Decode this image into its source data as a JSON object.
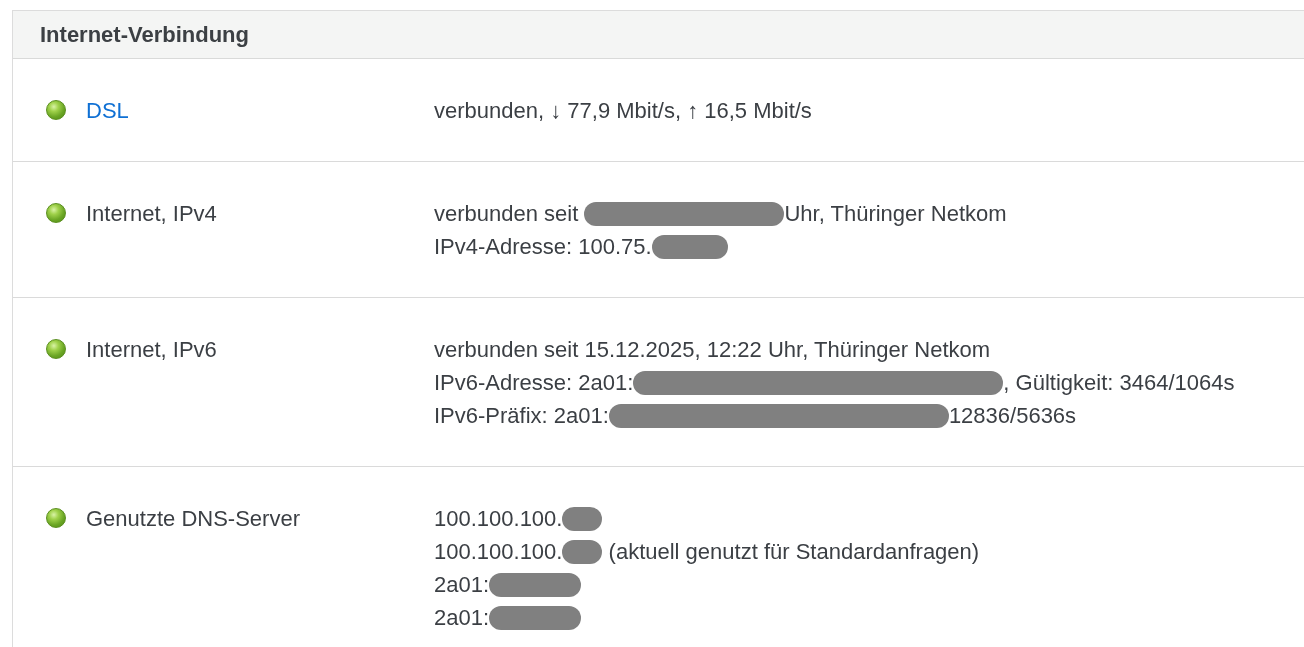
{
  "panel": {
    "title": "Internet-Verbindung"
  },
  "rows": [
    {
      "connected": true,
      "kind": "link",
      "label": "DSL",
      "lines": [
        [
          {
            "kind": "text",
            "text": "verbunden, ↓ 77,9 Mbit/s, ↑ 16,5 Mbit/s"
          }
        ]
      ]
    },
    {
      "connected": true,
      "kind": "text",
      "label": "Internet, IPv4",
      "lines": [
        [
          {
            "kind": "text",
            "text": "verbunden seit "
          },
          {
            "kind": "redacted"
          },
          {
            "kind": "text",
            "text": "Uhr, Thüringer Netkom"
          }
        ],
        [
          {
            "kind": "text",
            "text": "IPv4-Adresse: 100.75."
          },
          {
            "kind": "redacted"
          }
        ]
      ]
    },
    {
      "connected": true,
      "kind": "text",
      "label": "Internet, IPv6",
      "lines": [
        [
          {
            "kind": "text",
            "text": "verbunden seit 15.12.2025, 12:22 Uhr, Thüringer Netkom"
          }
        ],
        [
          {
            "kind": "text",
            "text": "IPv6-Adresse: 2a01:"
          },
          {
            "kind": "redacted"
          },
          {
            "kind": "text",
            "text": ", Gültigkeit: 3464/1064s"
          }
        ],
        [
          {
            "kind": "text",
            "text": "IPv6-Präfix: 2a01:"
          },
          {
            "kind": "redacted"
          },
          {
            "kind": "text",
            "text": "12836/5636s"
          }
        ]
      ]
    },
    {
      "connected": true,
      "kind": "text",
      "label": "Genutzte DNS-Server",
      "lines": [
        [
          {
            "kind": "text",
            "text": "100.100.100."
          },
          {
            "kind": "redacted"
          }
        ],
        [
          {
            "kind": "text",
            "text": "100.100.100."
          },
          {
            "kind": "redacted"
          },
          {
            "kind": "text",
            "text": " (aktuell genutzt für Standardanfragen)"
          }
        ],
        [
          {
            "kind": "text",
            "text": "2a01:"
          },
          {
            "kind": "redacted"
          }
        ],
        [
          {
            "kind": "text",
            "text": "2a01:"
          },
          {
            "kind": "redacted"
          }
        ]
      ]
    }
  ]
}
